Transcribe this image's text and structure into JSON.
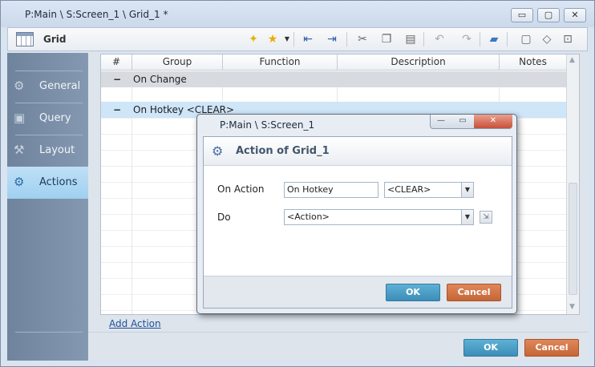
{
  "window": {
    "title": "P:Main \\ S:Screen_1 \\ Grid_1 *",
    "minimize_glyph": "▭",
    "maximize_glyph": "▢",
    "close_glyph": "✕"
  },
  "toolbar": {
    "title": "Grid",
    "icons": [
      "lightbulb-icon",
      "star-icon",
      "outdent-icon",
      "indent-icon",
      "cut-icon",
      "copy-icon",
      "paste-icon",
      "undo-icon",
      "redo-icon",
      "comment-icon",
      "speech-bubble-icon",
      "tag-icon",
      "export-icon"
    ]
  },
  "sidebar": {
    "items": [
      {
        "label": "General",
        "icon": "settings-icon"
      },
      {
        "label": "Query",
        "icon": "query-icon"
      },
      {
        "label": "Layout",
        "icon": "layout-icon"
      },
      {
        "label": "Actions",
        "icon": "actions-icon",
        "active": true
      }
    ]
  },
  "grid": {
    "columns": [
      "#",
      "Group",
      "Function",
      "Description",
      "Notes"
    ],
    "groups": [
      {
        "toggle": "−",
        "label": "On Change"
      },
      {
        "toggle": "−",
        "label": "On Hotkey <CLEAR>"
      }
    ]
  },
  "main": {
    "add_action_label": "Add Action",
    "ok_label": "OK",
    "cancel_label": "Cancel"
  },
  "dialog": {
    "title": "P:Main \\ S:Screen_1",
    "heading": "Action of Grid_1",
    "on_action_label": "On Action",
    "on_action_value": "On Hotkey",
    "on_action_key": "<CLEAR>",
    "do_label": "Do",
    "do_value": "<Action>",
    "ok_label": "OK",
    "cancel_label": "Cancel",
    "minimize_glyph": "—",
    "maximize_glyph": "▭",
    "close_glyph": "✕"
  },
  "colors": {
    "ok_button": "#3c8eb9",
    "cancel_button": "#c56636",
    "sidebar_active": "#9fd0f0",
    "sidebar": "#7d92aa"
  }
}
